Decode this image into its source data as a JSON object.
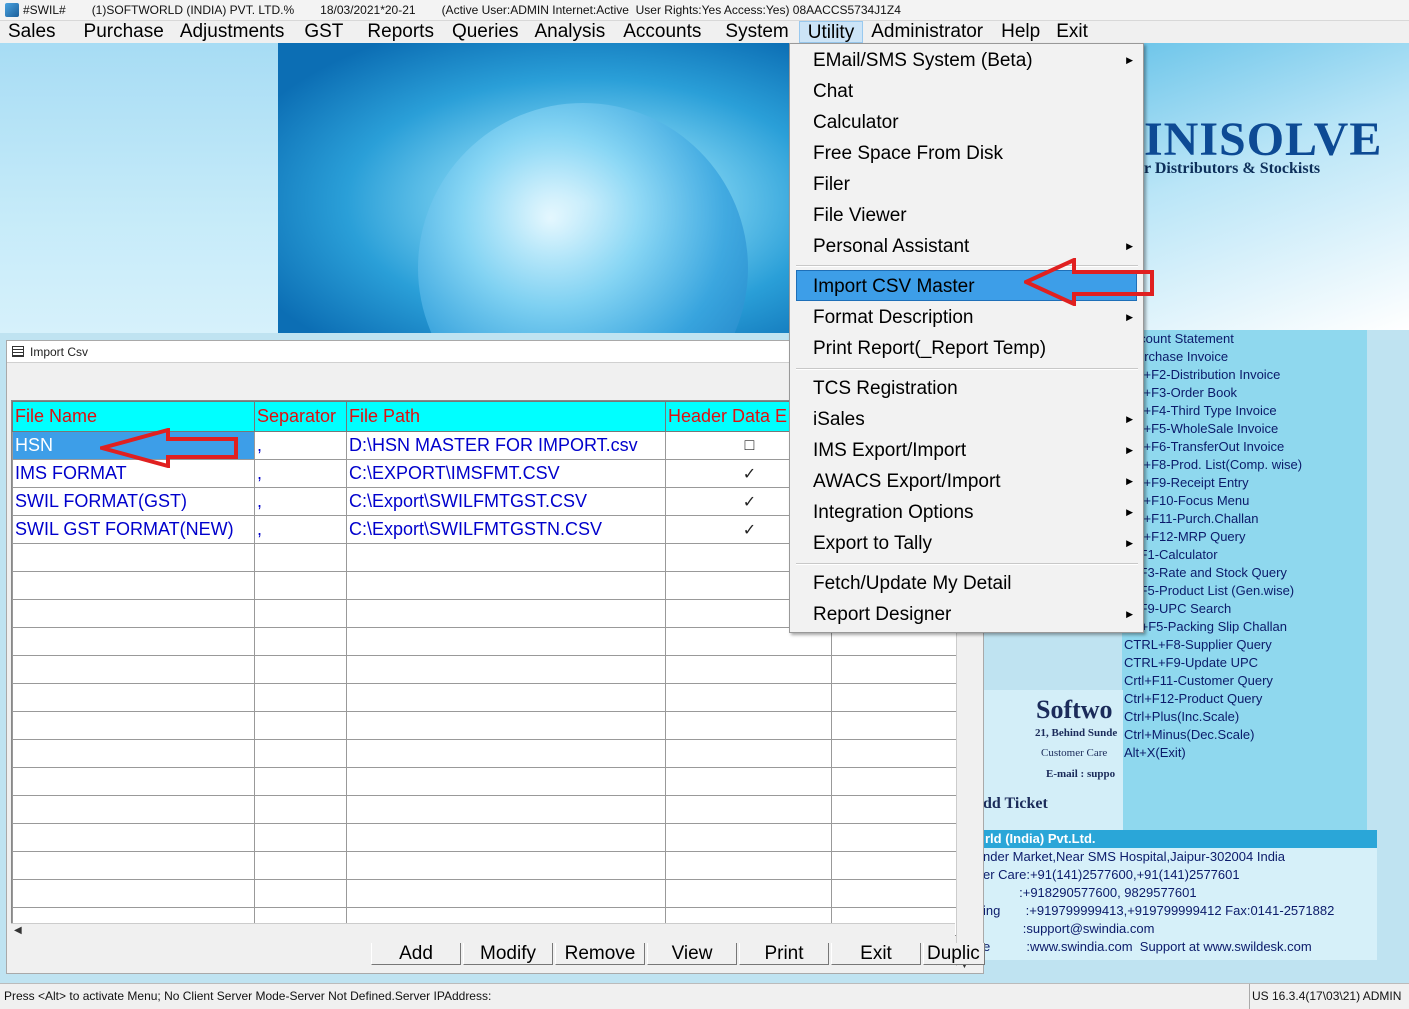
{
  "titlebar": {
    "app": "#SWIL#",
    "company": "(1)SOFTWORLD (INDIA) PVT. LTD.%",
    "date": "18/03/2021*20-21",
    "status": "(Active User:ADMIN Internet:Active  User Rights:Yes Access:Yes) 08AACCS5734J1Z4"
  },
  "menu": [
    "Sales",
    "Purchase",
    "Adjustments",
    "GST",
    "Reports",
    "Queries",
    "Analysis",
    "Accounts",
    "System",
    "Utility",
    "Administrator",
    "Help",
    "Exit"
  ],
  "brand": {
    "name": "INISOLVE",
    "tagline": "r Distributors & Stockists"
  },
  "utility_menu": {
    "group1": [
      "EMail/SMS System (Beta)",
      "Chat",
      "Calculator",
      "Free Space From Disk",
      "Filer",
      "File Viewer",
      "Personal Assistant"
    ],
    "group2": [
      "Import CSV Master",
      "Format Description",
      "Print Report(_Report Temp)"
    ],
    "group3": [
      "TCS Registration",
      "iSales",
      "IMS Export/Import",
      "AWACS Export/Import",
      "Integration Options",
      "Export to Tally"
    ],
    "group4": [
      "Fetch/Update My Detail",
      "Report Designer"
    ]
  },
  "csv_window": {
    "title": "Import Csv",
    "columns": [
      "File Name",
      "Separator",
      "File Path",
      "Header Data E"
    ],
    "rows": [
      {
        "name": "HSN",
        "sep": ",",
        "path": "D:\\HSN MASTER FOR IMPORT.csv",
        "header": "□"
      },
      {
        "name": "IMS FORMAT",
        "sep": ",",
        "path": "C:\\EXPORT\\IMSFMT.CSV",
        "header": "✓"
      },
      {
        "name": "SWIL FORMAT(GST)",
        "sep": ",",
        "path": "C:\\Export\\SWILFMTGST.CSV",
        "header": "✓"
      },
      {
        "name": "SWIL GST FORMAT(NEW)",
        "sep": ",",
        "path": "C:\\Export\\SWILFMTGSTN.CSV",
        "header": "✓"
      }
    ],
    "buttons": [
      "Add",
      "Modify",
      "Remove",
      "View",
      "Print",
      "Exit",
      "Duplic"
    ]
  },
  "shortcuts": [
    "Account Statement",
    "-Purchase Invoice",
    "IFT+F2-Distribution Invoice",
    "IFT+F3-Order Book",
    "IFT+F4-Third Type Invoice",
    "IFT+F5-WholeSale Invoice",
    "IFT+F6-TransferOut Invoice",
    "IFT+F8-Prod. List(Comp. wise)",
    "IFT+F9-Receipt Entry",
    "IFT+F10-Focus Menu",
    "IFT+F11-Purch.Challan",
    "IFT+F12-MRP Query",
    "T+F1-Calculator",
    "T+F3-Rate and Stock Query",
    "T+F5-Product List (Gen.wise)",
    "T+F9-UPC Search",
    "RL+F5-Packing Slip Challan",
    "CTRL+F8-Supplier Query",
    "CTRL+F9-Update UPC",
    "Crtl+F11-Customer Query",
    "Ctrl+F12-Product Query",
    "Ctrl+Plus(Inc.Scale)",
    "Ctrl+Minus(Dec.Scale)",
    "Alt+X(Exit)"
  ],
  "company_card": {
    "softwo": "Softwo",
    "addr": "21, Behind Sunde",
    "care": "Customer Care",
    "email": "E-mail : suppo",
    "add_ticket": "dd Ticket"
  },
  "info": {
    "head": "rld (India) Pvt.Ltd.",
    "lines": [
      "nder Market,Near SMS Hospital,Jaipur-302004 India",
      "er Care:+91(141)2577600,+91(141)2577601",
      "          :+918290577600, 9829577601",
      "ing       :+919799999413,+919799999412 Fax:0141-2571882",
      "           :support@swindia.com",
      "e          :www.swindia.com  Support at www.swildesk.com"
    ]
  },
  "statusbar": {
    "left": "Press <Alt> to activate Menu; No Client Server Mode-Server Not Defined.Server IPAddress:",
    "right": "US 16.3.4(17\\03\\21) ADMIN"
  },
  "colors": {
    "grid_header_bg": "#00ffff",
    "grid_header_text": "#e01010",
    "selection": "#3d9ee8",
    "arrow": "#e02020"
  }
}
